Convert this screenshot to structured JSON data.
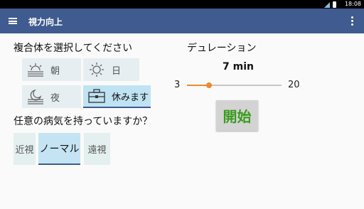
{
  "status": {
    "clock": "18:08"
  },
  "appbar": {
    "title": "視力向上"
  },
  "complex": {
    "heading": "複合体を選択してください",
    "options": [
      {
        "label": "朝",
        "icon": "sunrise-icon",
        "selected": false
      },
      {
        "label": "日",
        "icon": "sun-icon",
        "selected": false
      },
      {
        "label": "夜",
        "icon": "moon-icon",
        "selected": false
      },
      {
        "label": "休みます",
        "icon": "briefcase-icon",
        "selected": true
      }
    ]
  },
  "condition": {
    "heading": "任意の病気を持っていますか？",
    "options": [
      {
        "label": "近視",
        "selected": false
      },
      {
        "label": "ノーマル",
        "selected": true
      },
      {
        "label": "遠視",
        "selected": false
      }
    ]
  },
  "duration": {
    "heading": "デュレーション",
    "value_label": "7 min",
    "min": "3",
    "max": "20",
    "value": 7
  },
  "start_label": "開始",
  "colors": {
    "appbar": "#3f5b8f",
    "accent": "#f08a2c",
    "start_text": "#3a9b1f",
    "selected_card": "#bfe3f3"
  }
}
